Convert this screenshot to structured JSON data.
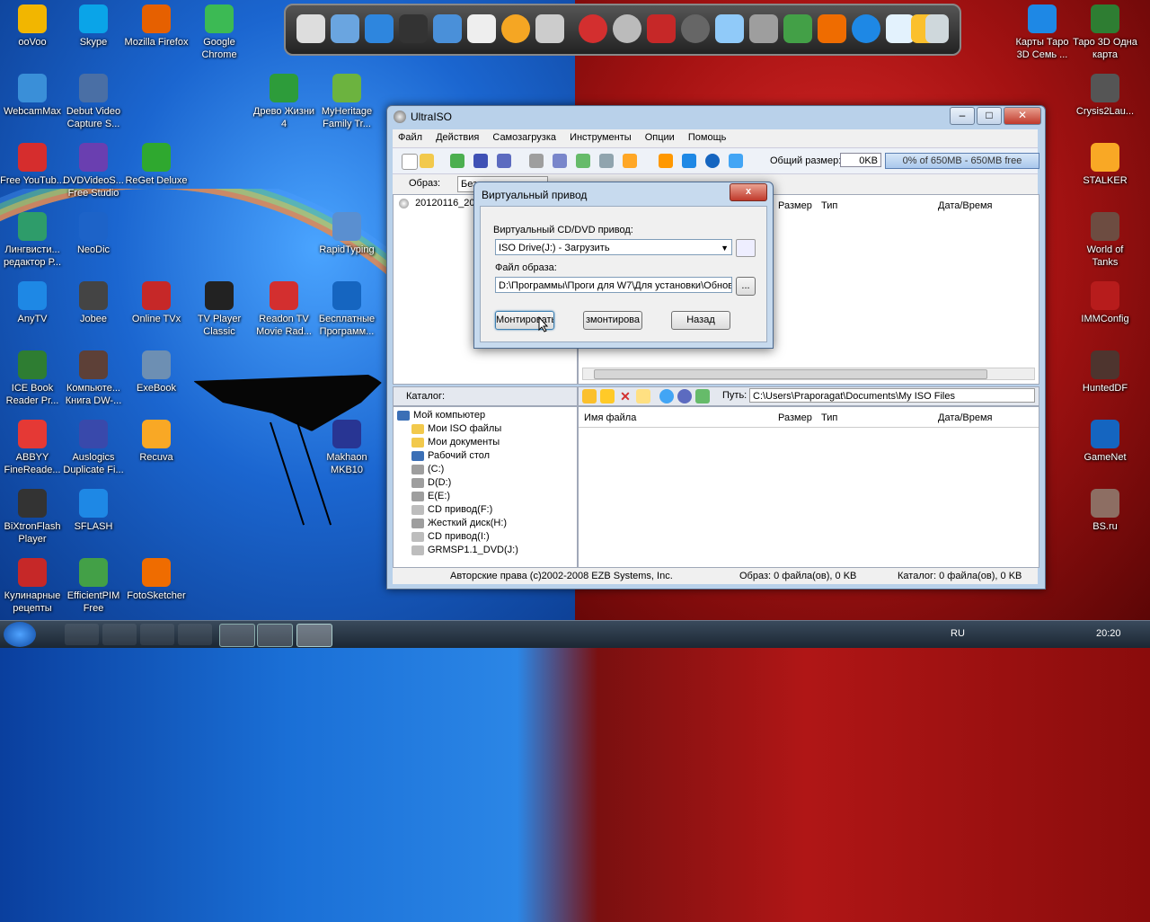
{
  "desktop_icons": [
    {
      "id": "oovoo",
      "label": "ooVoo",
      "color": "#f2b600"
    },
    {
      "id": "skype",
      "label": "Skype",
      "color": "#0aa4e8"
    },
    {
      "id": "firefox",
      "label": "Mozilla Firefox",
      "color": "#e66000"
    },
    {
      "id": "chrome",
      "label": "Google Chrome",
      "color": "#3cba54"
    },
    {
      "id": "webcammax",
      "label": "WebcamMax",
      "color": "#3a8fd8"
    },
    {
      "id": "debut",
      "label": "Debut Video Capture S...",
      "color": "#4a6fa5"
    },
    {
      "id": "drevo",
      "label": "Древо Жизни 4",
      "color": "#2d9c3a"
    },
    {
      "id": "myheritage",
      "label": "MyHeritage Family Tr...",
      "color": "#6cb33f"
    },
    {
      "id": "freeyoutube",
      "label": "Free YouTub...",
      "color": "#d62d2d"
    },
    {
      "id": "dvdvideosoft",
      "label": "DVDVideoS... Free Studio",
      "color": "#6a3fb0"
    },
    {
      "id": "reget",
      "label": "ReGet Deluxe",
      "color": "#2fa82f"
    },
    {
      "id": "lingvistic",
      "label": "Лингвисти... редактор Р...",
      "color": "#2e9c6a"
    },
    {
      "id": "neodic",
      "label": "NeoDic",
      "color": "#1d63c8"
    },
    {
      "id": "rapidtyping",
      "label": "RapidTyping",
      "color": "#5a8fd0"
    },
    {
      "id": "anytv",
      "label": "AnyTV",
      "color": "#1e88e5"
    },
    {
      "id": "jobee",
      "label": "Jobee",
      "color": "#444444"
    },
    {
      "id": "onlinetvx",
      "label": "Online TVx",
      "color": "#c62828"
    },
    {
      "id": "tvplayer",
      "label": "TV Player Classic",
      "color": "#222222"
    },
    {
      "id": "readontv",
      "label": "Readon TV Movie Rad...",
      "color": "#d32f2f"
    },
    {
      "id": "besplatnye",
      "label": "Бесплатные Программ...",
      "color": "#1565c0"
    },
    {
      "id": "icebook",
      "label": "ICE Book Reader Pr...",
      "color": "#2e7d32"
    },
    {
      "id": "kniga",
      "label": "Компьюте... Книга DW-...",
      "color": "#5d4037"
    },
    {
      "id": "exebook",
      "label": "ExeBook",
      "color": "#6d8fb3"
    },
    {
      "id": "abbyy",
      "label": "ABBYY FineReade...",
      "color": "#e53935"
    },
    {
      "id": "auslogics",
      "label": "Auslogics Duplicate Fi...",
      "color": "#3949ab"
    },
    {
      "id": "recuva",
      "label": "Recuva",
      "color": "#f9a825"
    },
    {
      "id": "makhaon",
      "label": "Makhaon MKB10",
      "color": "#283593"
    },
    {
      "id": "bixtron",
      "label": "BiXtronFlash Player",
      "color": "#333333"
    },
    {
      "id": "sflash",
      "label": "SFLASH",
      "color": "#1e88e5"
    },
    {
      "id": "kulinarnye",
      "label": "Кулинарные рецепты",
      "color": "#c62828"
    },
    {
      "id": "efficientpim",
      "label": "EfficientPIM Free",
      "color": "#43a047"
    },
    {
      "id": "fotosketcher",
      "label": "FotoSketcher",
      "color": "#ef6c00"
    },
    {
      "id": "karty",
      "label": "Карты Таро 3D Семь ...",
      "color": "#1e88e5"
    },
    {
      "id": "taro3d",
      "label": "Таро 3D Одна карта",
      "color": "#2e7d32"
    },
    {
      "id": "crysis",
      "label": "Crysis2Lau...",
      "color": "#555555"
    },
    {
      "id": "stalker",
      "label": "STALKER",
      "color": "#f9a825"
    },
    {
      "id": "worldoftanks",
      "label": "World of Tanks",
      "color": "#6d4c41"
    },
    {
      "id": "immconfig",
      "label": "IMMConfig",
      "color": "#b71c1c"
    },
    {
      "id": "hunteddf",
      "label": "HuntedDF",
      "color": "#4e342e"
    },
    {
      "id": "gamenet",
      "label": "GameNet",
      "color": "#1565c0"
    },
    {
      "id": "bsru",
      "label": "BS.ru",
      "color": "#8d6e63"
    }
  ],
  "window": {
    "title": "UltraISO",
    "minimize": "‒",
    "maximize": "□",
    "close": "✕",
    "menu": [
      "Файл",
      "Действия",
      "Самозагрузка",
      "Инструменты",
      "Опции",
      "Помощь"
    ],
    "total_size_label": "Общий размер:",
    "total_size_value": "0KB",
    "capacity_text": "0% of 650MB - 650MB free",
    "image_label": "Образ:",
    "image_type": "Без самозагрузки",
    "iso_root": "20120116_201",
    "upper_columns": [
      "Размер",
      "Тип",
      "Дата/Время"
    ],
    "catalog_label": "Каталог:",
    "path_label": "Путь:",
    "path_value": "C:\\Users\\Praporagat\\Documents\\My ISO Files",
    "lower_columns": [
      "Имя файла",
      "Размер",
      "Тип",
      "Дата/Время"
    ],
    "tree": [
      {
        "label": "Мой компьютер",
        "color": "#3b6fb6"
      },
      {
        "label": "Мои ISO файлы",
        "color": "#f2c94c"
      },
      {
        "label": "Мои документы",
        "color": "#f2c94c"
      },
      {
        "label": "Рабочий стол",
        "color": "#3b6fb6"
      },
      {
        "label": "(C:)",
        "color": "#9e9e9e"
      },
      {
        "label": "D(D:)",
        "color": "#9e9e9e"
      },
      {
        "label": "E(E:)",
        "color": "#9e9e9e"
      },
      {
        "label": "CD привод(F:)",
        "color": "#bdbdbd"
      },
      {
        "label": "Жесткий диск(H:)",
        "color": "#9e9e9e"
      },
      {
        "label": "CD привод(I:)",
        "color": "#bdbdbd"
      },
      {
        "label": "GRMSP1.1_DVD(J:)",
        "color": "#bdbdbd"
      }
    ],
    "status_copyright": "Авторские права (c)2002-2008 EZB Systems, Inc.",
    "status_image": "Образ: 0 файла(ов), 0 KB",
    "status_catalog": "Каталог: 0 файла(ов), 0 KB"
  },
  "dialog": {
    "title": "Виртуальный привод",
    "close": "x",
    "drive_label": "Виртуальный CD/DVD привод:",
    "drive_value": "ISO Drive(J:) - Загрузить",
    "file_label": "Файл образа:",
    "file_value": "D:\\Программы\\Проги для W7\\Для установки\\Обнов",
    "browse": "...",
    "mount": "Монтировать",
    "unmount": "змонтирова",
    "back": "Назад"
  },
  "taskbar": {
    "lang": "RU",
    "clock": "20:20"
  }
}
